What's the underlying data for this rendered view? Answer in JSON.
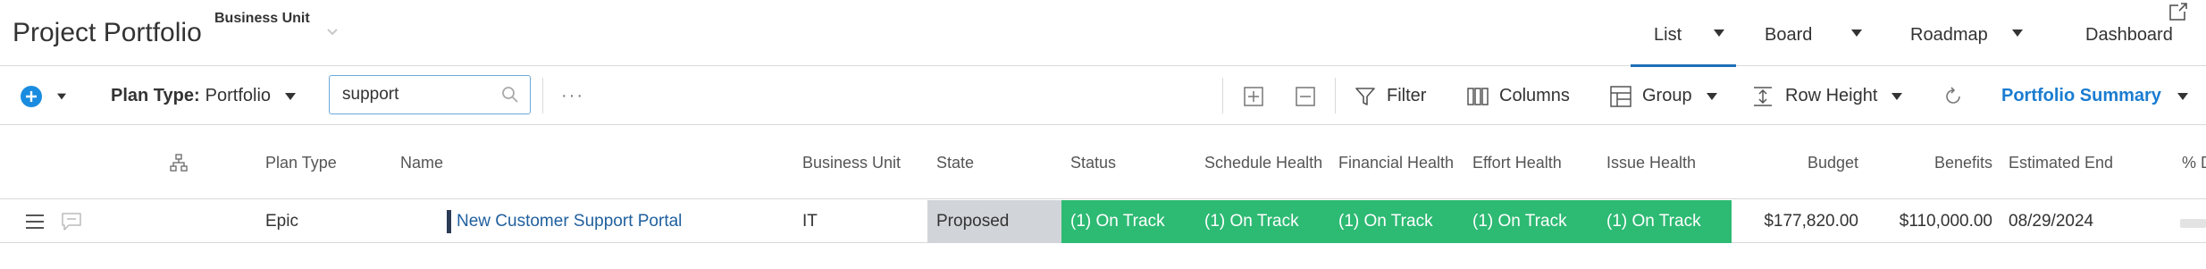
{
  "header": {
    "title": "Project Portfolio",
    "business_unit_label": "Business Unit",
    "views": [
      {
        "label": "List",
        "active": true,
        "has_menu": true
      },
      {
        "label": "Board",
        "active": false,
        "has_menu": true
      },
      {
        "label": "Roadmap",
        "active": false,
        "has_menu": true
      },
      {
        "label": "Dashboard",
        "active": false,
        "has_menu": false
      }
    ]
  },
  "toolbar": {
    "plan_type_label": "Plan Type:",
    "plan_type_value": "Portfolio",
    "search_value": "support",
    "more_label": "···",
    "filter_label": "Filter",
    "columns_label": "Columns",
    "group_label": "Group",
    "row_height_label": "Row Height",
    "summary_label": "Portfolio Summary"
  },
  "table": {
    "columns": [
      "Plan Type",
      "Name",
      "Business Unit",
      "State",
      "Status",
      "Schedule Health",
      "Financial Health",
      "Effort Health",
      "Issue Health",
      "Budget",
      "Benefits",
      "Estimated End",
      "% D"
    ],
    "rows": [
      {
        "plan_type": "Epic",
        "name": "New Customer Support Portal",
        "business_unit": "IT",
        "state": "Proposed",
        "status": "(1) On Track",
        "schedule_health": "(1) On Track",
        "financial_health": "(1) On Track",
        "effort_health": "(1) On Track",
        "issue_health": "(1) On Track",
        "budget": "$177,820.00",
        "benefits": "$110,000.00",
        "estimated_end": "08/29/2024"
      }
    ]
  },
  "colors": {
    "accent": "#1e6fb8",
    "health_on_track": "#2dba73",
    "state_proposed": "#d1d4d9",
    "add_button": "#1a8ce0"
  }
}
